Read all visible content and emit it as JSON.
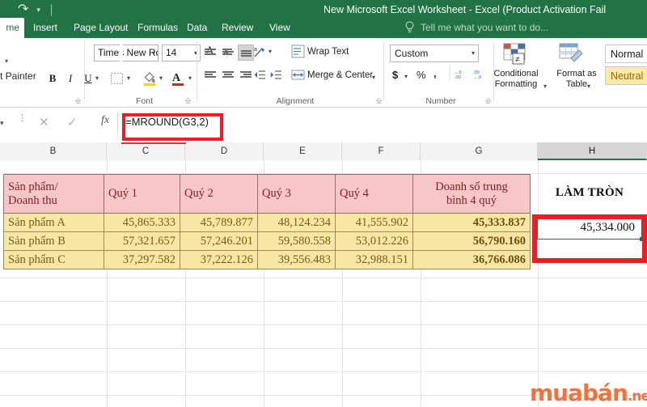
{
  "window": {
    "title": "New Microsoft Excel Worksheet - Excel (Product Activation Fail",
    "accent_green": "#217346",
    "quick_access": [
      "redo-icon",
      "undo-caret-icon",
      "customize-qat-icon"
    ]
  },
  "ribbon": {
    "tabs": [
      {
        "label": "me",
        "active": true
      },
      {
        "label": "Insert",
        "active": false
      },
      {
        "label": "Page Layout",
        "active": false
      },
      {
        "label": "Formulas",
        "active": false
      },
      {
        "label": "Data",
        "active": false
      },
      {
        "label": "Review",
        "active": false
      },
      {
        "label": "View",
        "active": false
      }
    ],
    "tell_me": "Tell me what you want to do...",
    "clipboard": {
      "format_painter": "t Painter",
      "group_label": ""
    },
    "font": {
      "group_label": "Font",
      "family": "Times New Ro",
      "size": "14",
      "grow_font": "A",
      "shrink_font": "A",
      "bold": "B",
      "italic": "I",
      "underline": "U"
    },
    "alignment": {
      "group_label": "Alignment",
      "wrap_text": "Wrap Text",
      "merge_center": "Merge & Center"
    },
    "number": {
      "group_label": "Number",
      "format": "Custom",
      "currency": "$",
      "percent": "%",
      "comma": ",",
      "inc_dec": ".00",
      "dec_dec": ".0"
    },
    "styles": {
      "conditional_formatting_l1": "Conditional",
      "conditional_formatting_l2": "Formatting",
      "format_as_table_l1": "Format as",
      "format_as_table_l2": "Table",
      "style_normal": "Normal",
      "style_neutral": "Neutral"
    }
  },
  "formula_bar": {
    "cancel_icon": "✕",
    "enter_icon": "✓",
    "fx_icon": "fx",
    "formula": "=MROUND(G3,2)",
    "highlight_color": "#ee1c25"
  },
  "sheet": {
    "column_headers": [
      {
        "label": "B",
        "active": false
      },
      {
        "label": "C",
        "active": false
      },
      {
        "label": "D",
        "active": false
      },
      {
        "label": "E",
        "active": false
      },
      {
        "label": "F",
        "active": false
      },
      {
        "label": "G",
        "active": false
      },
      {
        "label": "H",
        "active": true
      }
    ],
    "table": {
      "header_fill": "#f7c6c9",
      "header_text": "#7d1f23",
      "data_fill": "#f8e6a4",
      "data_text": "#7a5c16",
      "headers": [
        "Sản phẩm/\nDoanh thu",
        "Quý 1",
        "Quý 2",
        "Quý 3",
        "Quý 4",
        "Doanh số trung\nbình 4 quý"
      ],
      "headers_line1": [
        "Sản phẩm/",
        "Quý 1",
        "Quý 2",
        "Quý 3",
        "Quý 4",
        "Doanh số trung"
      ],
      "headers_line2": [
        "Doanh thu",
        "",
        "",
        "",
        "",
        "bình 4 quý"
      ],
      "rows": [
        {
          "label": "Sản phẩm A",
          "q1": "45,865.333",
          "q2": "45,789.877",
          "q3": "48,124.234",
          "q4": "41,555.902",
          "avg": "45,333.837"
        },
        {
          "label": "Sản phẩm B",
          "q1": "57,321.657",
          "q2": "57,246.201",
          "q3": "59,580.558",
          "q4": "53,012.226",
          "avg": "56,790.160"
        },
        {
          "label": "Sản phẩm C",
          "q1": "37,297.582",
          "q2": "37,222.126",
          "q3": "39,556.483",
          "q4": "32,988.151",
          "avg": "36,766.086"
        }
      ]
    },
    "lam_tron_header": "LÀM TRÒN",
    "selected_cell": {
      "reference": "H3",
      "value": "45,334.000",
      "border_color": "#21734a"
    }
  },
  "watermark": {
    "brand": "muabán",
    "suffix": ".net",
    "color": "#f2713c"
  }
}
